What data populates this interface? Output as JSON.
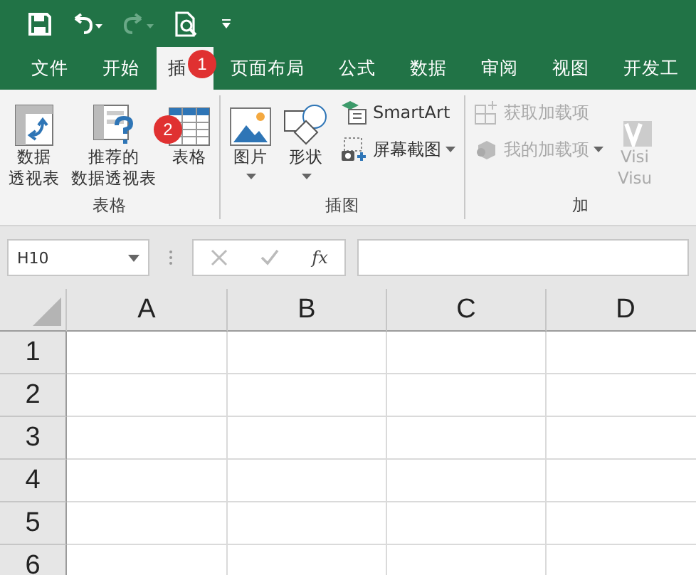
{
  "tabs": [
    {
      "label": "文件",
      "selected": false
    },
    {
      "label": "开始",
      "selected": false
    },
    {
      "label": "插",
      "selected": true,
      "badge": "1"
    },
    {
      "label": "页面布局",
      "selected": false
    },
    {
      "label": "公式",
      "selected": false
    },
    {
      "label": "数据",
      "selected": false
    },
    {
      "label": "审阅",
      "selected": false
    },
    {
      "label": "视图",
      "selected": false
    },
    {
      "label": "开发工",
      "selected": false
    }
  ],
  "ribbon": {
    "groups": [
      {
        "label": "表格",
        "buttons": [
          {
            "kind": "large",
            "lines": [
              "数据",
              "透视表"
            ],
            "disabled": false,
            "dropdown": false
          },
          {
            "kind": "large",
            "lines": [
              "推荐的",
              "数据透视表"
            ],
            "disabled": false,
            "dropdown": false
          },
          {
            "kind": "large",
            "lines": [
              "表格"
            ],
            "disabled": false,
            "dropdown": false,
            "badge": "2"
          }
        ]
      },
      {
        "label": "插图",
        "buttons": [
          {
            "kind": "large",
            "lines": [
              "图片"
            ],
            "disabled": false,
            "dropdown": true
          },
          {
            "kind": "large",
            "lines": [
              "形状"
            ],
            "disabled": false,
            "dropdown": true
          },
          {
            "kind": "small",
            "lines": [
              "SmartArt"
            ],
            "disabled": false,
            "dropdown": false
          },
          {
            "kind": "small",
            "lines": [
              "屏幕截图"
            ],
            "disabled": false,
            "dropdown": true
          }
        ]
      },
      {
        "label": "加",
        "buttons": [
          {
            "kind": "small",
            "lines": [
              "获取加载项"
            ],
            "disabled": true,
            "dropdown": false
          },
          {
            "kind": "small",
            "lines": [
              "我的加载项"
            ],
            "disabled": true,
            "dropdown": true
          },
          {
            "kind": "large",
            "lines": [
              "Visi",
              "Visu"
            ],
            "disabled": true,
            "dropdown": false
          }
        ]
      }
    ]
  },
  "formula_bar": {
    "name_box": "H10",
    "fx": "fx"
  },
  "sheet": {
    "columns": [
      "A",
      "B",
      "C",
      "D"
    ],
    "rows": [
      "1",
      "2",
      "3",
      "4",
      "5",
      "6"
    ]
  }
}
